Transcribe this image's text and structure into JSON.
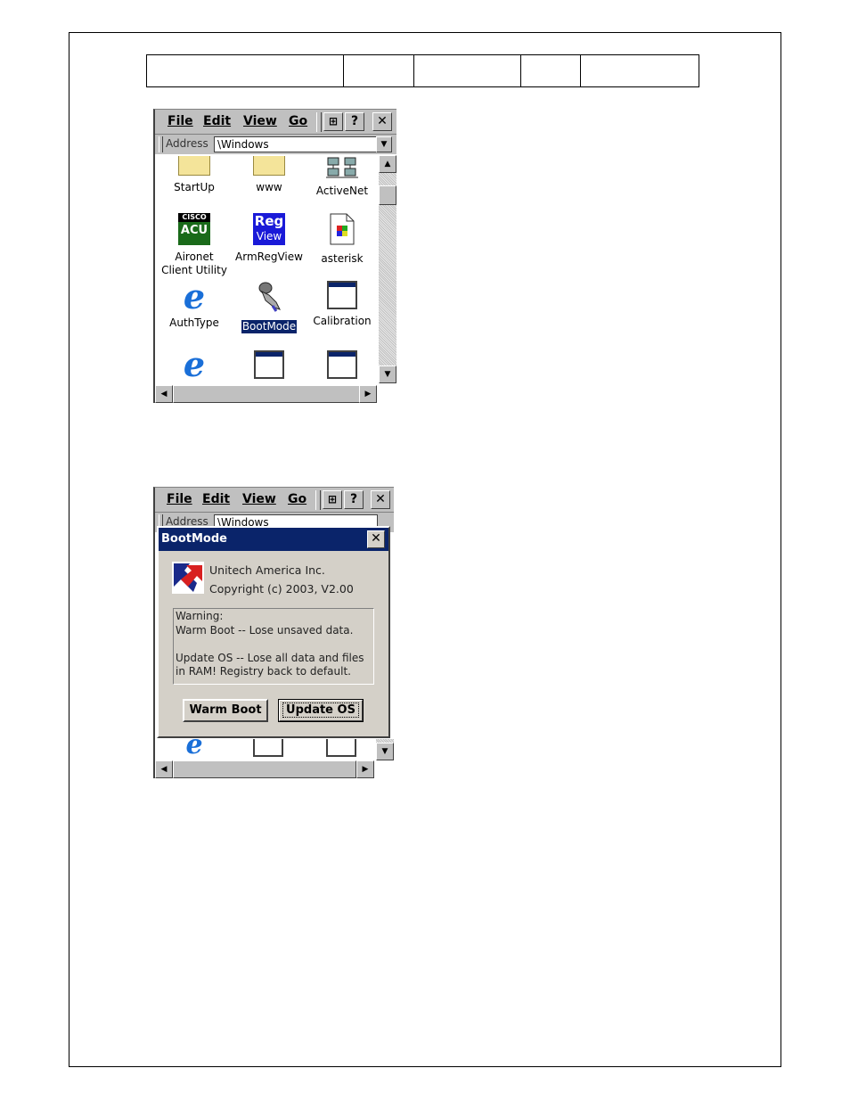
{
  "header_cells": [
    "",
    "",
    "",
    "",
    ""
  ],
  "window1": {
    "menu": [
      "File",
      "Edit",
      "View",
      "Go"
    ],
    "toolbar": {
      "properties_icon": "properties-icon",
      "help_label": "?",
      "close_label": "✕"
    },
    "address": {
      "label": "Address",
      "value": "\\Windows"
    },
    "icons": [
      {
        "label": "StartUp",
        "icon": "folder-icon"
      },
      {
        "label": "www",
        "icon": "folder-icon"
      },
      {
        "label": "ActiveNet",
        "icon": "network-icon"
      },
      {
        "label": "Aironet Client Utility",
        "icon": "cisco-acu-icon",
        "badge_top": "CISCO",
        "badge_bottom": "ACU"
      },
      {
        "label": "ArmRegView",
        "icon": "regview-icon",
        "badge_top": "Reg",
        "badge_bottom": "View"
      },
      {
        "label": "asterisk",
        "icon": "document-icon"
      },
      {
        "label": "AuthType",
        "icon": "internet-explorer-icon"
      },
      {
        "label": "BootMode",
        "icon": "bootmode-hand-icon",
        "selected": true
      },
      {
        "label": "Calibration",
        "icon": "application-window-icon"
      },
      {
        "label": "",
        "icon": "internet-explorer-icon"
      },
      {
        "label": "",
        "icon": "application-window-icon"
      },
      {
        "label": "",
        "icon": "application-window-icon"
      }
    ]
  },
  "window2": {
    "menu": [
      "File",
      "Edit",
      "View",
      "Go"
    ],
    "toolbar": {
      "help_label": "?",
      "close_label": "✕"
    },
    "address": {
      "label": "Address",
      "value": "\\Windows"
    },
    "dialog": {
      "title": "BootMode",
      "close_label": "✕",
      "company": "Unitech America Inc.",
      "copyright": "Copyright (c) 2003, V2.00",
      "warning_lines": [
        "Warning:",
        "Warm Boot -- Lose unsaved data.",
        "",
        "Update OS -- Lose all data and files",
        "in RAM! Registry back to default."
      ],
      "buttons": {
        "warm_boot": "Warm Boot",
        "update_os": "Update OS"
      }
    }
  }
}
